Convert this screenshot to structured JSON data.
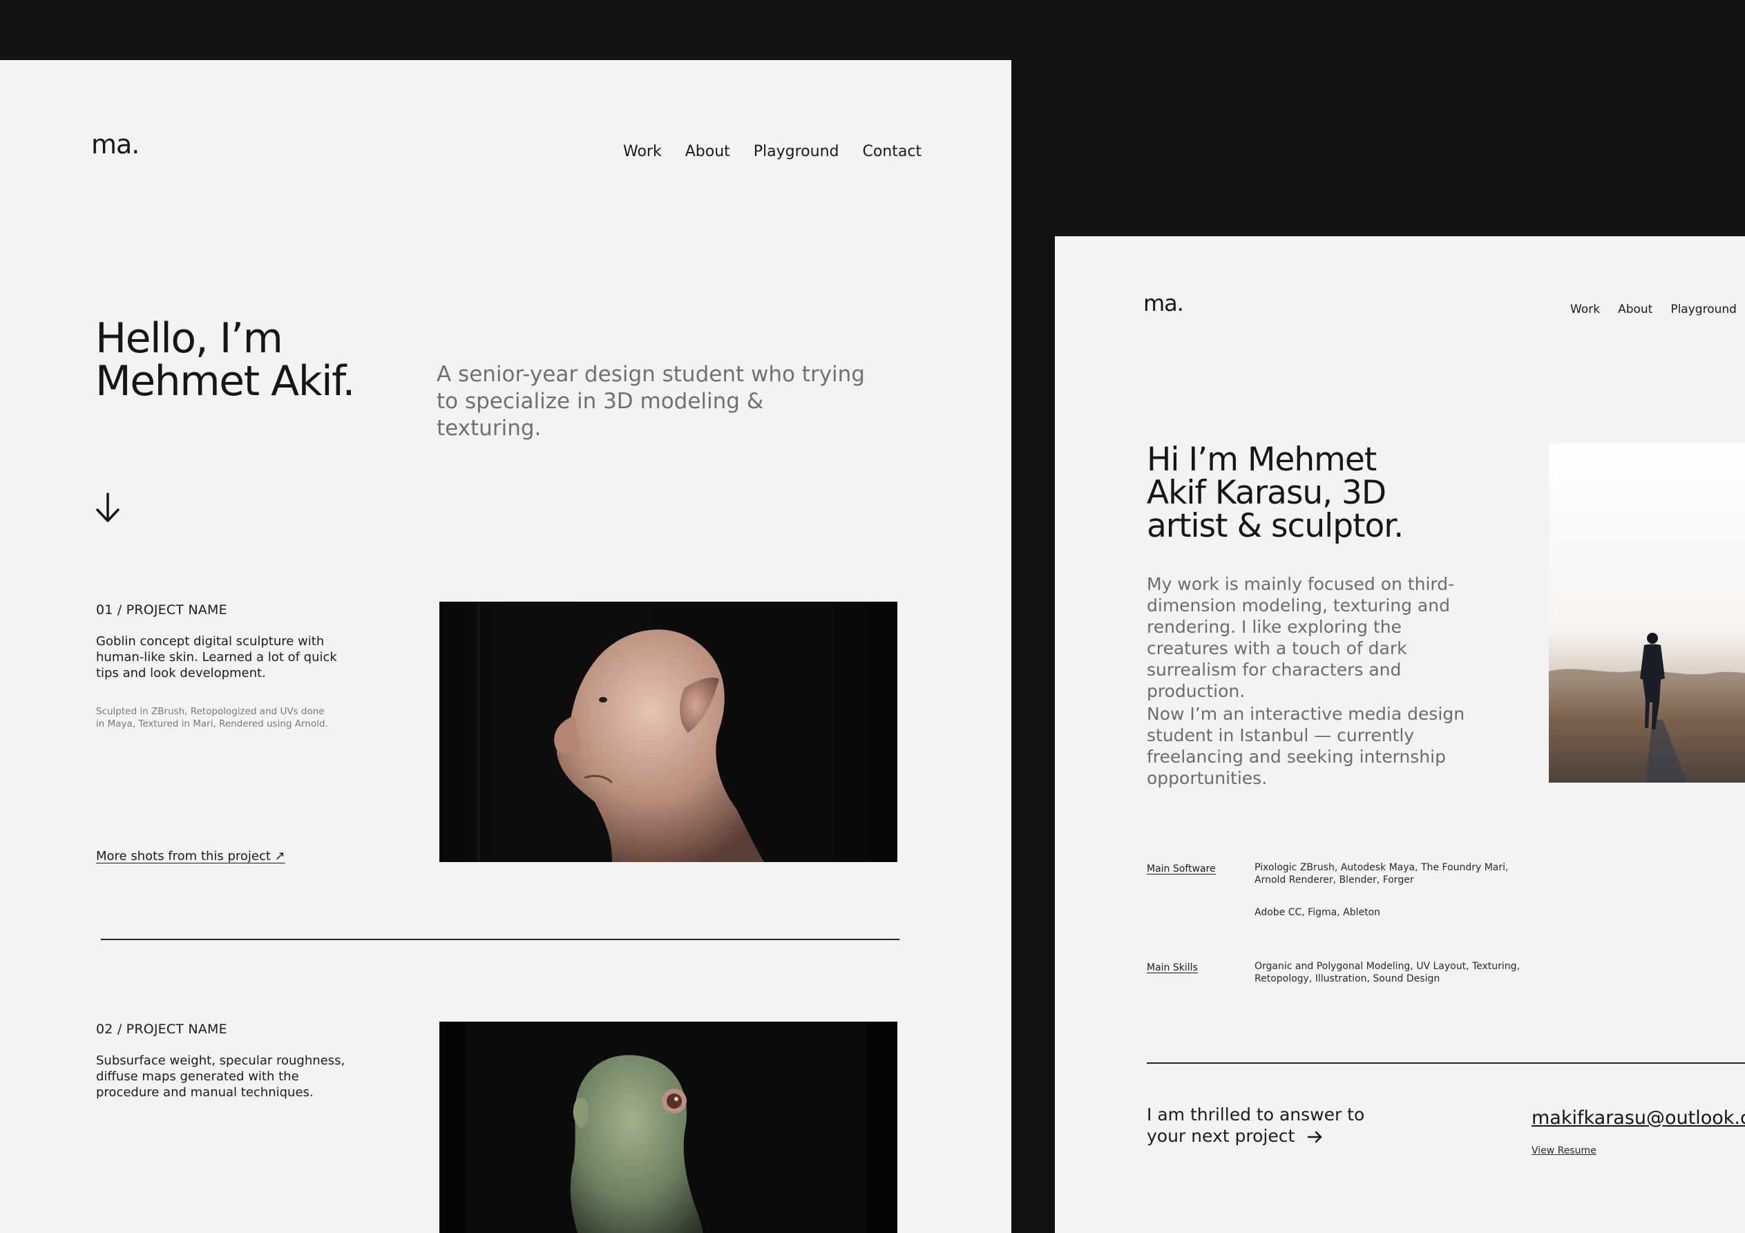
{
  "left_page": {
    "logo": "ma.",
    "nav": [
      "Work",
      "About",
      "Playground",
      "Contact"
    ],
    "hero": {
      "title_line1": "Hello, I’m",
      "title_line2": "Mehmet Akif.",
      "subtitle": "A senior-year design student who trying to specialize in 3D modeling & texturing."
    },
    "projects": [
      {
        "heading": "01 / PROJECT NAME",
        "description": "Goblin concept digital sculpture with human-like skin. Learned a lot of quick tips and look development.",
        "tech": "Sculpted in ZBrush, Retopologized and UVs done in Maya, Textured in Mari, Rendered using Arnold.",
        "link": "More shots from this project ↗"
      },
      {
        "heading": "02 / PROJECT NAME",
        "description": "Subsurface weight, specular roughness, diffuse maps generated with the procedure and manual techniques."
      }
    ]
  },
  "right_page": {
    "logo": "ma.",
    "nav": [
      "Work",
      "About",
      "Playground"
    ],
    "title": "Hi I’m Mehmet Akif Karasu, 3D artist & sculptor.",
    "paragraph1": "My work is mainly focused on third-dimension modeling, texturing and rendering. I like exploring the creatures with a touch of dark surrealism for characters and production.",
    "paragraph2": "Now I’m an interactive media design student in Istanbul — currently freelancing and seeking internship opportunities.",
    "software": {
      "label": "Main Software",
      "value1": "Pixologic ZBrush, Autodesk Maya, The Foundry Mari, Arnold Renderer, Blender, Forger",
      "value2": "Adobe CC, Figma, Ableton"
    },
    "skills": {
      "label": "Main Skills",
      "value": "Organic and Polygonal Modeling, UV Layout, Texturing, Retopology, Illustration, Sound Design"
    },
    "cta": "I am thrilled to answer to your next project",
    "email": "makifkarasu@outlook.com",
    "resume": "View Resume"
  },
  "colors": {
    "outer_background": "#121212",
    "page_background": "#f3f3f3",
    "text": "#161616",
    "muted_text": "#707070"
  },
  "icons": [
    "down-arrow-icon",
    "external-link-arrow-icon",
    "right-arrow-icon"
  ]
}
